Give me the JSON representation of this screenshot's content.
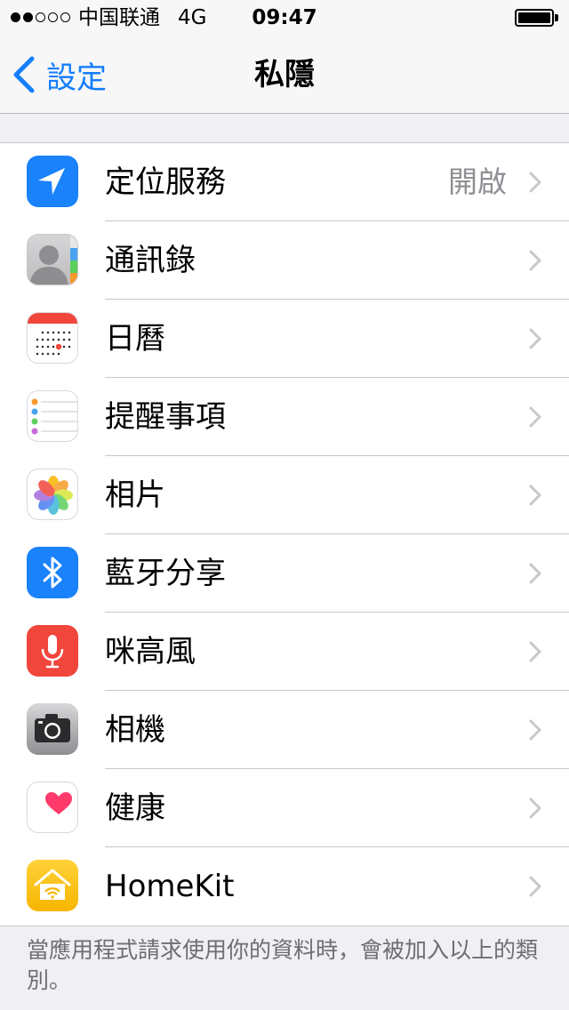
{
  "status_bar": {
    "signal_strength": 2,
    "signal_total": 5,
    "carrier": "中国联通",
    "network": "4G",
    "time": "09:47",
    "battery_level": 1.0
  },
  "nav": {
    "back_label": "設定",
    "title": "私隱"
  },
  "items": [
    {
      "label": "定位服務",
      "value": "開啟",
      "icon": "location-arrow-icon"
    },
    {
      "label": "通訊錄",
      "value": "",
      "icon": "contacts-icon"
    },
    {
      "label": "日曆",
      "value": "",
      "icon": "calendar-icon"
    },
    {
      "label": "提醒事項",
      "value": "",
      "icon": "reminders-icon"
    },
    {
      "label": "相片",
      "value": "",
      "icon": "photos-icon"
    },
    {
      "label": "藍牙分享",
      "value": "",
      "icon": "bluetooth-icon"
    },
    {
      "label": "咪高風",
      "value": "",
      "icon": "microphone-icon"
    },
    {
      "label": "相機",
      "value": "",
      "icon": "camera-icon"
    },
    {
      "label": "健康",
      "value": "",
      "icon": "heart-icon"
    },
    {
      "label": "HomeKit",
      "value": "",
      "icon": "home-icon"
    }
  ],
  "footer": "當應用程式請求使用你的資料時，會被加入以上的類別。",
  "colors": {
    "accent": "#157efb",
    "background": "#efeff4",
    "secondary_text": "#8e8e93",
    "footer_text": "#6d6d72"
  }
}
